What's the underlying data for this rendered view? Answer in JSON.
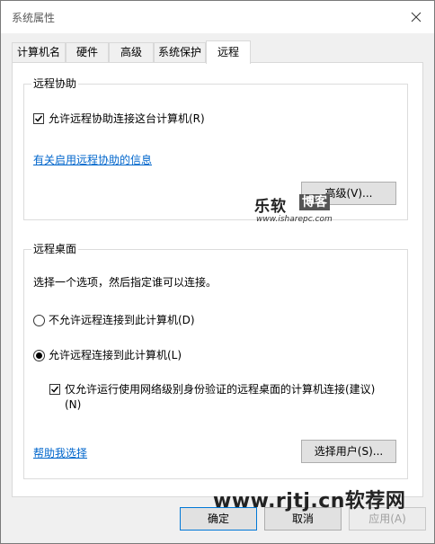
{
  "window": {
    "title": "系统属性"
  },
  "tabs": [
    {
      "label": "计算机名",
      "active": false
    },
    {
      "label": "硬件",
      "active": false
    },
    {
      "label": "高级",
      "active": false
    },
    {
      "label": "系统保护",
      "active": false
    },
    {
      "label": "远程",
      "active": true
    }
  ],
  "remote_assistance": {
    "legend": "远程协助",
    "allow_checkbox_label": "允许远程协助连接这台计算机(R)",
    "allow_checked": true,
    "info_link": "有关启用远程协助的信息",
    "advanced_button": "高级(V)..."
  },
  "remote_desktop": {
    "legend": "远程桌面",
    "instruction": "选择一个选项，然后指定谁可以连接。",
    "option_disallow": "不允许远程连接到此计算机(D)",
    "option_allow": "允许远程连接到此计算机(L)",
    "selected_option": "allow",
    "nla_checkbox_line1": "仅允许运行使用网络级别身份验证的远程桌面的计算机连接(建议)",
    "nla_checkbox_line2": "(N)",
    "nla_checked": true,
    "help_link": "帮助我选择",
    "select_users_button": "选择用户(S)..."
  },
  "footer": {
    "ok_button": "确定",
    "cancel_button": "取消",
    "apply_button": "应用(A)"
  },
  "watermarks": {
    "top_logo_text_1": "乐软",
    "top_logo_text_2": "博客",
    "top_logo_url": "www.isharepc.com",
    "bottom_text": "www.rjtj.cn软荐网"
  }
}
